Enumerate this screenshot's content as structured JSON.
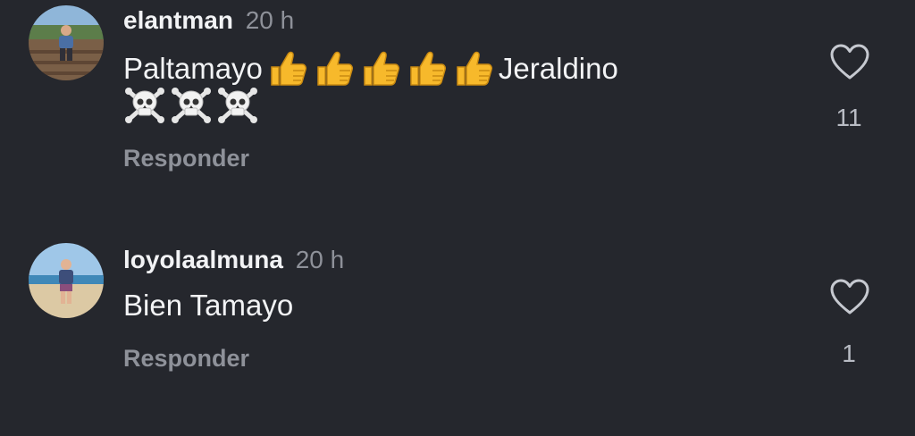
{
  "comments": [
    {
      "username": "elantman",
      "time": "20 h",
      "text_before": "Paltamayo",
      "text_after": "Jeraldino",
      "thumbs_count": 5,
      "skull_count": 3,
      "reply_label": "Responder",
      "like_count": "11",
      "avatar_icon": "avatar-person-on-boardwalk",
      "like_icon": "heart-outline-icon"
    },
    {
      "username": "loyolaalmuna",
      "time": "20 h",
      "text": "Bien Tamayo",
      "reply_label": "Responder",
      "like_count": "1",
      "avatar_icon": "avatar-person-on-beach",
      "like_icon": "heart-outline-icon"
    }
  ],
  "colors": {
    "background": "#25272d",
    "primary_text": "#f2f3f5",
    "secondary_text": "#8e9199",
    "emoji_yellow": "#f7b92b"
  }
}
